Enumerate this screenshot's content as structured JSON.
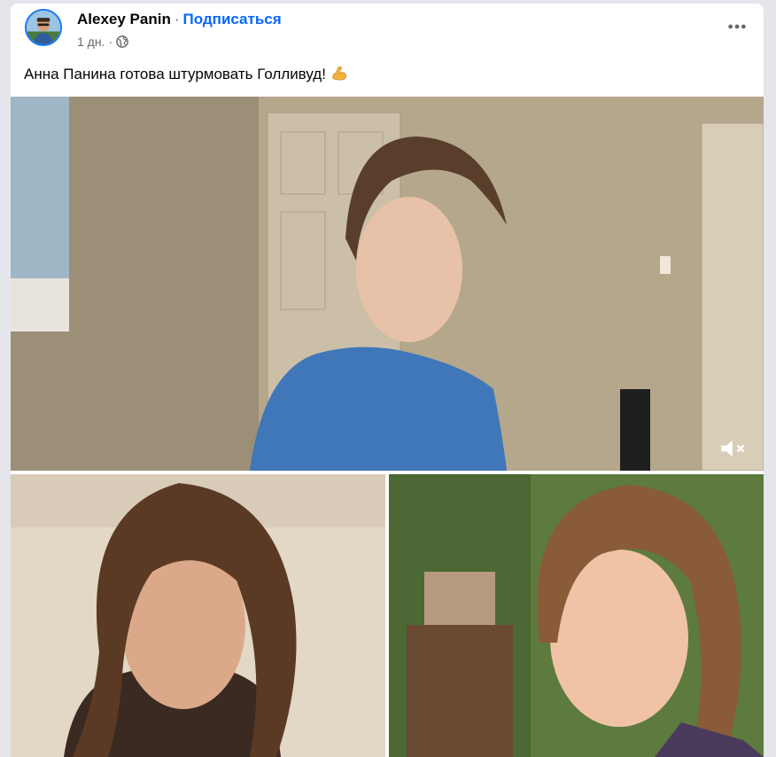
{
  "post": {
    "author": "Alexey Panin",
    "separator": "·",
    "subscribe_label": "Подписаться",
    "time": "1 дн.",
    "meta_separator": "·",
    "privacy_icon": "globe-icon",
    "more_icon": "more-options-icon",
    "text": "Анна Панина готова штурмовать Голливуд!",
    "emoji_icon": "flexed-biceps-icon"
  },
  "media": {
    "video": {
      "muted": true,
      "mute_icon": "speaker-muted-icon"
    },
    "photos_count_shown": 2
  },
  "colors": {
    "link_blue": "#0866ff",
    "text_primary": "#050505",
    "text_secondary": "#65676b",
    "page_background": "#e4e6eb",
    "card_background": "#ffffff"
  }
}
